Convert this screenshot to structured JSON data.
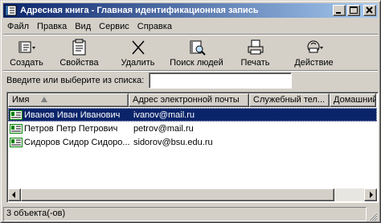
{
  "window": {
    "title": "Адресная книга - Главная идентификационная запись"
  },
  "menu": [
    {
      "label": "Файл"
    },
    {
      "label": "Правка"
    },
    {
      "label": "Вид"
    },
    {
      "label": "Сервис"
    },
    {
      "label": "Справка"
    }
  ],
  "toolbar": [
    {
      "label": "Создать",
      "icon": "new-contact-icon"
    },
    {
      "label": "Свойства",
      "icon": "properties-icon"
    },
    {
      "label": "Удалить",
      "icon": "delete-icon"
    },
    {
      "label": "Поиск людей",
      "icon": "find-people-icon"
    },
    {
      "label": "Печать",
      "icon": "print-icon"
    },
    {
      "label": "Действие",
      "icon": "action-icon"
    }
  ],
  "search": {
    "label": "Введите или выберите из списка:",
    "value": ""
  },
  "columns": [
    {
      "label": "Имя"
    },
    {
      "label": "Адрес электронной почты"
    },
    {
      "label": "Служебный тел..."
    },
    {
      "label": "Домашний"
    }
  ],
  "contacts": [
    {
      "name": "Иванов Иван Иванович",
      "email": "ivanov@mail.ru",
      "selected": true
    },
    {
      "name": "Петров Петр Петрович",
      "email": "petrov@mail.ru",
      "selected": false
    },
    {
      "name": "Сидоров Сидор Сидоро...",
      "email": "sidorov@bsu.edu.ru",
      "selected": false
    }
  ],
  "status": {
    "text": "3 объекта(-ов)"
  },
  "colors": {
    "titlebar_start": "#0a246a",
    "titlebar_end": "#a6caf0",
    "selection": "#0a246a",
    "face": "#d4d0c8"
  }
}
